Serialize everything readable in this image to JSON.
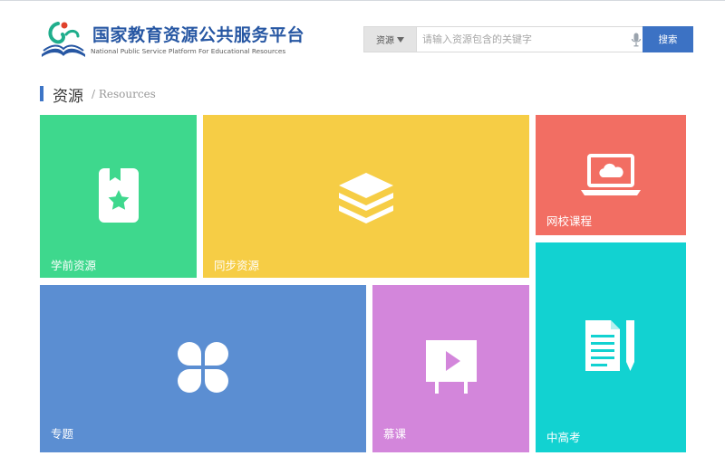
{
  "brand": {
    "name_cn": "国家教育资源公共服务平台",
    "name_en": "National Public  Service Platform For Educational Resources",
    "colors": {
      "primary": "#2757a3",
      "accent_green": "#1fae8c"
    }
  },
  "search": {
    "category": "资源",
    "placeholder": "请输入资源包含的关键字",
    "button_label": "搜索"
  },
  "section": {
    "title": "资源",
    "subtitle": "/ Resources"
  },
  "tiles": [
    {
      "label": "学前资源",
      "color": "#3ed88d",
      "icon": "bookmark-star-icon"
    },
    {
      "label": "同步资源",
      "color": "#f6cd45",
      "icon": "layers-icon"
    },
    {
      "label": "网校课程",
      "color": "#f26e63",
      "icon": "laptop-cloud-icon"
    },
    {
      "label": "专题",
      "color": "#5b8ed2",
      "icon": "clover-icon"
    },
    {
      "label": "慕课",
      "color": "#d386db",
      "icon": "video-board-icon"
    },
    {
      "label": "中高考",
      "color": "#12d2d1",
      "icon": "document-pencil-icon"
    }
  ]
}
